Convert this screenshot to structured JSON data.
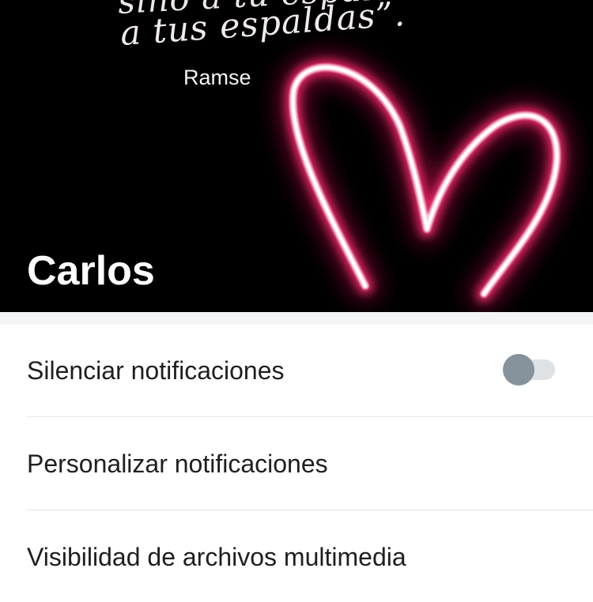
{
  "header": {
    "quote_line_top": "sino a tu espalda",
    "quote_line_main": "a tus espaldas”.",
    "quote_author": "Ramse",
    "contact_name": "Carlos"
  },
  "settings": {
    "mute_notifications": {
      "label": "Silenciar notificaciones",
      "enabled": false
    },
    "custom_notifications": {
      "label": "Personalizar notificaciones"
    },
    "media_visibility": {
      "label": "Visibilidad de archivos multimedia"
    }
  },
  "colors": {
    "header_background": "#000000",
    "neon_heart": "#ff2a6d",
    "toggle_thumb_off": "#86929c",
    "toggle_track_off": "#dfe2e5",
    "text_primary": "#1f1f1f"
  }
}
